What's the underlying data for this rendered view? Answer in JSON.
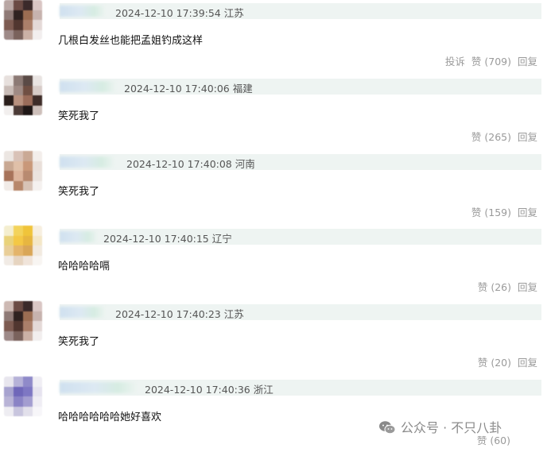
{
  "comments": [
    {
      "time": "2024-12-10 17:39:54",
      "location": "江苏",
      "text": "几根白发丝也能把孟姐钓成这样",
      "report": "投诉",
      "like": "赞 (709)",
      "reply": "回复",
      "avatar_colors": [
        "#b9a7a4",
        "#6b4b44",
        "#3b2a2a",
        "#d9c6c4",
        "#8f7a76",
        "#2f2220",
        "#9b6d52",
        "#c7b3ae",
        "#7d5b51",
        "#51362f",
        "#ab7f6a",
        "#e4d9d7",
        "#9e8a88",
        "#7a625c",
        "#cbb1a6",
        "#f2eeee"
      ]
    },
    {
      "time": "2024-12-10 17:40:06",
      "location": "福建",
      "text": "笑死我了",
      "report": "",
      "like": "赞 (265)",
      "reply": "回复",
      "avatar_colors": [
        "#e7e0dd",
        "#8c7a75",
        "#5a4a46",
        "#e9e4e2",
        "#c9bcb7",
        "#9f8a84",
        "#704f43",
        "#d7ccc8",
        "#2a1e1b",
        "#b8917f",
        "#9a6c5a",
        "#3e2d29",
        "#f2efee",
        "#4b3a36",
        "#1f1716",
        "#cdbfba"
      ]
    },
    {
      "time": "2024-12-10 17:40:08",
      "location": "河南",
      "text": "笑死我了",
      "report": "",
      "like": "赞 (159)",
      "reply": "回复",
      "avatar_colors": [
        "#ece6e2",
        "#d9c2b7",
        "#caa995",
        "#f3eeeb",
        "#c9a892",
        "#e0c0a8",
        "#c99879",
        "#e9dfd9",
        "#a7735a",
        "#dcb49c",
        "#b88a70",
        "#ebe3de",
        "#f1ebe7",
        "#b7876b",
        "#d8c3b6",
        "#f5f1ef"
      ]
    },
    {
      "time": "2024-12-10 17:40:15",
      "location": "辽宁",
      "text": "哈哈哈哈嗝",
      "report": "",
      "like": "赞 (26)",
      "reply": "回复",
      "avatar_colors": [
        "#f4eecf",
        "#f3d35b",
        "#f0c43a",
        "#f7efe0",
        "#e9d27a",
        "#f4c845",
        "#e7b640",
        "#f4e7c8",
        "#e9ce98",
        "#e4b46a",
        "#d9a657",
        "#f2eadf",
        "#f1ebe5",
        "#e6d4c0",
        "#f0e4da",
        "#f8f5f2"
      ]
    },
    {
      "time": "2024-12-10 17:40:23",
      "location": "江苏",
      "text": "笑死我了",
      "report": "",
      "like": "赞 (20)",
      "reply": "回复",
      "avatar_colors": [
        "#cdb9b3",
        "#6b4b44",
        "#3b2a2a",
        "#d9c6c4",
        "#8f7a76",
        "#2f2220",
        "#9b6d52",
        "#c7b3ae",
        "#7d5b51",
        "#51362f",
        "#ab7f6a",
        "#e4d9d7",
        "#9e8a88",
        "#7a625c",
        "#cbb1a6",
        "#f2eeee"
      ]
    },
    {
      "time": "2024-12-10 17:40:36",
      "location": "浙江",
      "text": "哈哈哈哈哈哈她好喜欢",
      "report": "",
      "like": "赞 (60)",
      "reply": "",
      "avatar_colors": [
        "#e8e6ee",
        "#b6b2d8",
        "#8f8ac9",
        "#f0eef4",
        "#a7a3cf",
        "#6f67b9",
        "#7e77c3",
        "#e6e3ef",
        "#b8b3d6",
        "#8a83c5",
        "#a39dd0",
        "#efedf4",
        "#eeedf2",
        "#c8c5de",
        "#e2e0eb",
        "#f7f6f9"
      ]
    }
  ],
  "watermark": {
    "text": "公众号 · 不只八卦"
  }
}
